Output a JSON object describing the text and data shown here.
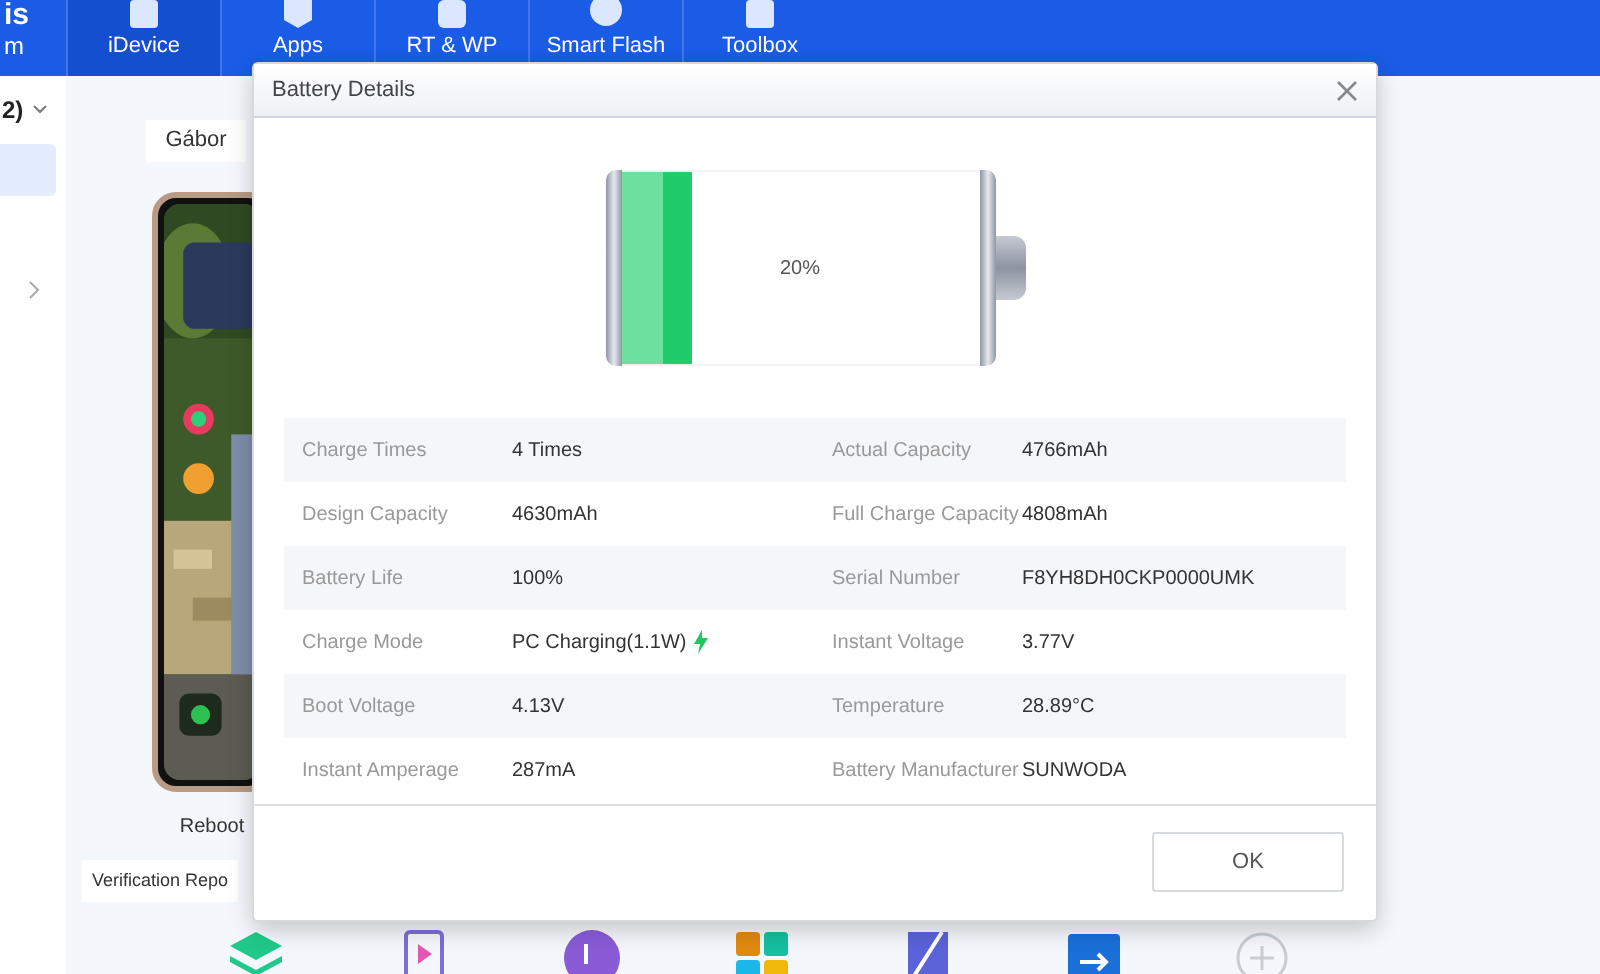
{
  "brand": {
    "title": "is",
    "subtitle": "m"
  },
  "nav": [
    {
      "label": "iDevice",
      "selected": true
    },
    {
      "label": "Apps",
      "selected": false
    },
    {
      "label": "RT & WP",
      "selected": false
    },
    {
      "label": "Smart Flash",
      "selected": false
    },
    {
      "label": "Toolbox",
      "selected": false
    }
  ],
  "sidebar": {
    "device_selector": "2)"
  },
  "device": {
    "name": "Gábor",
    "actions": [
      "Reboot"
    ],
    "report_button": "Verification Repo"
  },
  "dialog": {
    "title": "Battery Details",
    "battery": {
      "level": 0.2,
      "reading": "20%"
    },
    "fields": [
      {
        "label": "Charge Times",
        "value": "4 Times",
        "kind": "plain"
      },
      {
        "label": "Actual Capacity",
        "value": "4766mAh",
        "kind": "plain"
      },
      {
        "label": "Design Capacity",
        "value": "4630mAh",
        "kind": "plain"
      },
      {
        "label": "Full Charge Capacity",
        "value": "4808mAh",
        "kind": "plain"
      },
      {
        "label": "Battery Life",
        "value": "100%",
        "kind": "plain"
      },
      {
        "label": "Serial Number",
        "value": "F8YH8DH0CKP0000UMK",
        "kind": "plain"
      },
      {
        "label": "Charge Mode",
        "value": "PC Charging(1.1W)",
        "kind": "charging"
      },
      {
        "label": "Instant Voltage",
        "value": "3.77V",
        "kind": "plain"
      },
      {
        "label": "Boot Voltage",
        "value": "4.13V",
        "kind": "plain"
      },
      {
        "label": "Temperature",
        "value": "28.89°C",
        "kind": "plain"
      },
      {
        "label": "Instant Amperage",
        "value": "287mA",
        "kind": "plain"
      },
      {
        "label": "Battery Manufacturer",
        "value": "SUNWODA",
        "kind": "plain"
      }
    ],
    "ok_button": "OK"
  }
}
